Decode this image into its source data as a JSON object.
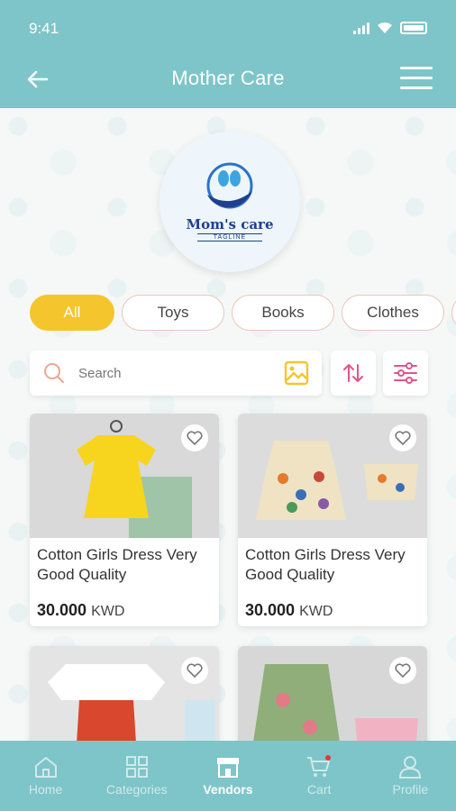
{
  "status": {
    "time": "9:41"
  },
  "header": {
    "title": "Mother Care"
  },
  "logo": {
    "name": "Mom's care",
    "tagline": "TAGLINE"
  },
  "categories": [
    {
      "label": "All",
      "active": true
    },
    {
      "label": "Toys",
      "active": false
    },
    {
      "label": "Books",
      "active": false
    },
    {
      "label": "Clothes",
      "active": false
    }
  ],
  "search": {
    "placeholder": "Search"
  },
  "products": [
    {
      "title": "Cotton Girls Dress Very Good Quality",
      "price": "30.000",
      "currency": "KWD"
    },
    {
      "title": "Cotton Girls Dress Very Good Quality",
      "price": "30.000",
      "currency": "KWD"
    },
    {
      "title": "",
      "price": "",
      "currency": ""
    },
    {
      "title": "",
      "price": "",
      "currency": ""
    }
  ],
  "nav": {
    "items": [
      {
        "label": "Home",
        "icon": "home-icon"
      },
      {
        "label": "Categories",
        "icon": "grid-icon"
      },
      {
        "label": "Vendors",
        "icon": "store-icon",
        "active": true
      },
      {
        "label": "Cart",
        "icon": "cart-icon"
      },
      {
        "label": "Profile",
        "icon": "profile-icon"
      }
    ]
  },
  "colors": {
    "primary": "#7ec5c9",
    "accent": "#f5c52d",
    "icon_accent": "#e0558a"
  }
}
